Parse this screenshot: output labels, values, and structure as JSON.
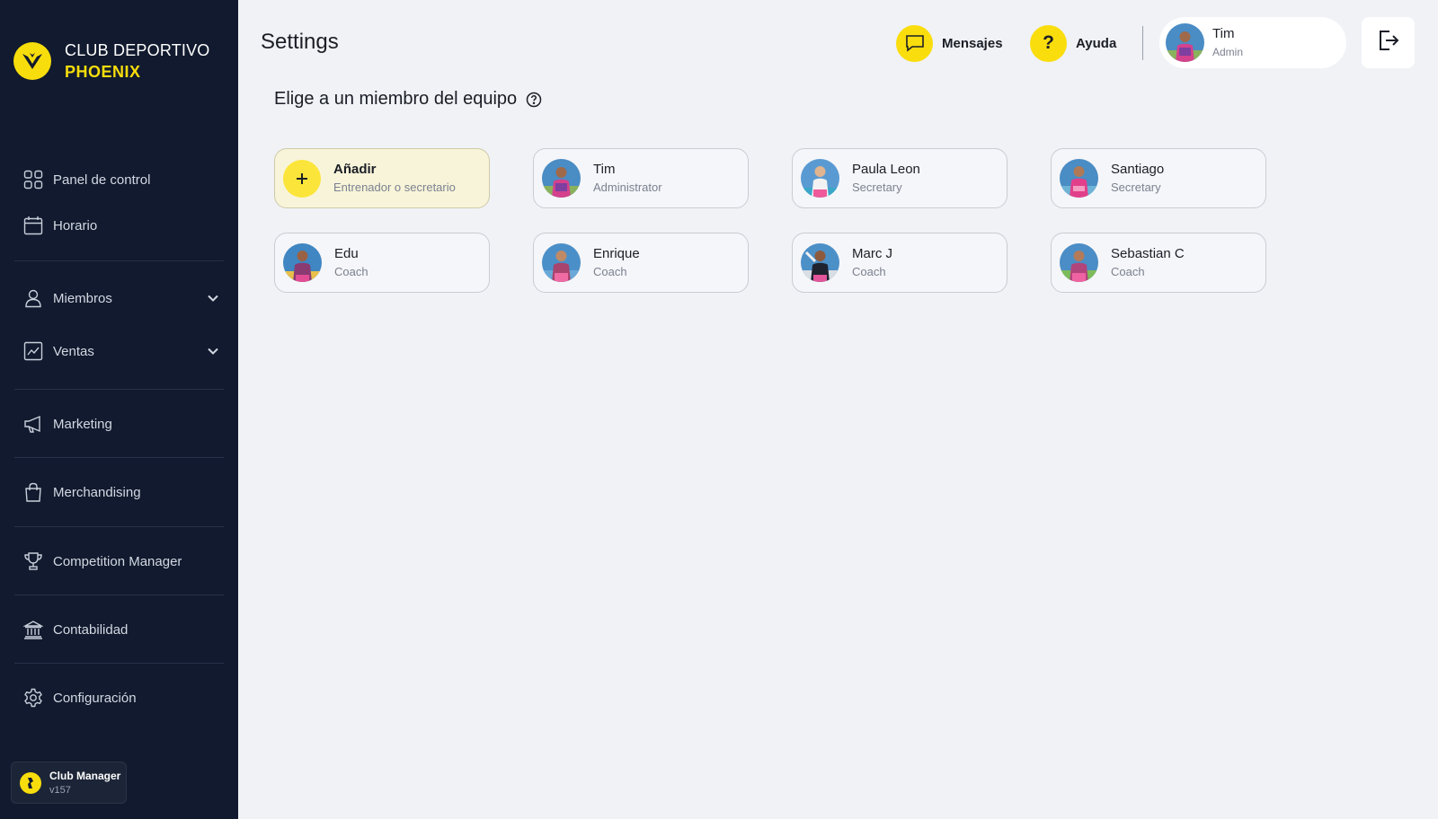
{
  "brand": {
    "line1": "CLUB DEPORTIVO",
    "line2": "PHOENIX",
    "logo_icon": "phoenix-logo-icon"
  },
  "sidebar": {
    "items": [
      {
        "label": "Panel de control",
        "icon": "dashboard-grid-icon"
      },
      {
        "label": "Horario",
        "icon": "calendar-icon"
      },
      {
        "label": "Miembros",
        "icon": "user-icon",
        "expandable": true
      },
      {
        "label": "Ventas",
        "icon": "chart-line-icon",
        "expandable": true
      },
      {
        "label": "Marketing",
        "icon": "megaphone-icon"
      },
      {
        "label": "Merchandising",
        "icon": "shopping-bag-icon"
      },
      {
        "label": "Competition Manager",
        "icon": "trophy-icon"
      },
      {
        "label": "Contabilidad",
        "icon": "bank-icon"
      },
      {
        "label": "Configuración",
        "icon": "gear-icon"
      }
    ],
    "version": {
      "name": "Club Manager",
      "number": "v157"
    }
  },
  "header": {
    "title": "Settings",
    "messages_label": "Mensajes",
    "help_label": "Ayuda",
    "help_symbol": "?",
    "user": {
      "name": "Tim",
      "role": "Admin"
    }
  },
  "section": {
    "title": "Elige a un miembro del equipo"
  },
  "members": [
    {
      "name": "Añadir",
      "role": "Entrenador o secretario",
      "type": "add"
    },
    {
      "name": "Tim",
      "role": "Administrator"
    },
    {
      "name": "Paula Leon",
      "role": "Secretary"
    },
    {
      "name": "Santiago",
      "role": "Secretary"
    },
    {
      "name": "Edu",
      "role": "Coach"
    },
    {
      "name": "Enrique",
      "role": "Coach"
    },
    {
      "name": "Marc J",
      "role": "Coach"
    },
    {
      "name": "Sebastian C",
      "role": "Coach"
    }
  ],
  "colors": {
    "sidebar_bg": "#111a2e",
    "accent_yellow": "#fadd0d",
    "page_bg": "#f0f2f6"
  }
}
